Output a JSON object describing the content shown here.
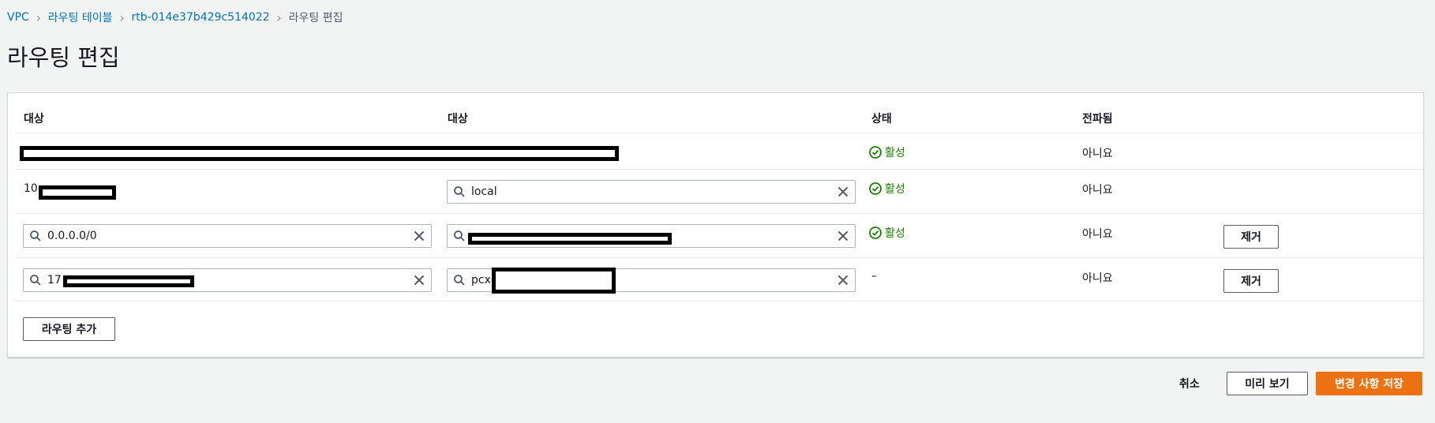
{
  "breadcrumb": {
    "items": [
      "VPC",
      "라우팅 테이블",
      "rtb-014e37b429c514022"
    ],
    "current": "라우팅 편집"
  },
  "page_title": "라우팅 편집",
  "table": {
    "headers": [
      "대상",
      "대상",
      "상태",
      "전파됨"
    ],
    "rows": [
      {
        "destination": "",
        "target": "",
        "status": "활성",
        "propagated": "아니요"
      },
      {
        "destination": "10.",
        "target": "local",
        "status": "활성",
        "propagated": "아니요"
      },
      {
        "destination": "0.0.0.0/0",
        "target": "",
        "status": "활성",
        "propagated": "아니요",
        "remove": "제거"
      },
      {
        "destination": "17",
        "target": "pcx",
        "status": "–",
        "propagated": "아니요",
        "remove": "제거"
      }
    ]
  },
  "add_route_label": "라우팅 추가",
  "footer": {
    "cancel": "취소",
    "preview": "미리 보기",
    "save": "변경 사항 저장"
  },
  "colors": {
    "link": "#0073bb",
    "success": "#1d8102",
    "primary": "#ec7211"
  },
  "icons": [
    "chevron-right-icon",
    "search-icon",
    "clear-icon",
    "status-check-icon"
  ]
}
